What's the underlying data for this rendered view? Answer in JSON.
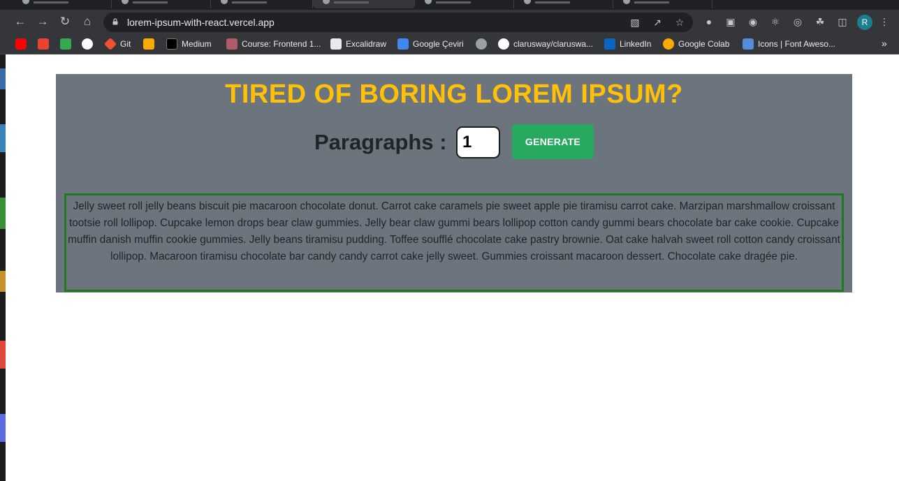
{
  "browser": {
    "url": "lorem-ipsum-with-react.vercel.app",
    "bookmarks": [
      {
        "label": "",
        "icon": "youtube-icon",
        "color": "#ff0000"
      },
      {
        "label": "",
        "icon": "gmail-icon",
        "color": "#ea4335"
      },
      {
        "label": "",
        "icon": "google-drive-icon",
        "color": "#34a853"
      },
      {
        "label": "",
        "icon": "github-icon",
        "color": "#ffffff"
      },
      {
        "label": "Git",
        "icon": "git-icon",
        "color": "#f05033"
      },
      {
        "label": "",
        "icon": "terminal-icon",
        "color": "#f9ab00"
      },
      {
        "label": "Medium",
        "icon": "medium-icon",
        "color": "#000000"
      },
      {
        "label": "Course: Frontend 1...",
        "icon": "course-icon",
        "color": "#b05a6a"
      },
      {
        "label": "Excalidraw",
        "icon": "excalidraw-icon",
        "color": "#e8eaed"
      },
      {
        "label": "Google Çeviri",
        "icon": "google-translate-icon",
        "color": "#4285f4"
      },
      {
        "label": "",
        "icon": "globe-icon",
        "color": "#9aa0a6"
      },
      {
        "label": "clarusway/claruswa...",
        "icon": "github-icon",
        "color": "#ffffff"
      },
      {
        "label": "LinkedIn",
        "icon": "linkedin-icon",
        "color": "#0a66c2"
      },
      {
        "label": "Google Colab",
        "icon": "colab-icon",
        "color": "#f9ab00"
      },
      {
        "label": "Icons | Font Aweso...",
        "icon": "flag-icon",
        "color": "#538dd7"
      }
    ],
    "more": "»",
    "profile_initial": "R"
  },
  "page": {
    "title": "TIRED OF BORING LOREM IPSUM?",
    "paragraphs_label": "Paragraphs :",
    "paragraphs_value": "1",
    "generate_label": "GENERATE",
    "output": "Jelly sweet roll jelly beans biscuit pie macaroon chocolate donut. Carrot cake caramels pie sweet apple pie tiramisu carrot cake. Marzipan marshmallow croissant tootsie roll lollipop. Cupcake lemon drops bear claw gummies. Jelly bear claw gummi bears lollipop cotton candy gummi bears chocolate bar cake cookie. Cupcake muffin danish muffin cookie gummies. Jelly beans tiramisu pudding. Toffee soufflé chocolate cake pastry brownie. Oat cake halvah sweet roll cotton candy croissant lollipop. Macaroon tiramisu chocolate bar candy candy carrot cake jelly sweet. Gummies croissant macaroon dessert. Chocolate cake dragée pie."
  },
  "colors": {
    "title": "#ffc107",
    "panel": "#6c757d",
    "button": "#28a960",
    "output_border": "#1f7a1f"
  }
}
